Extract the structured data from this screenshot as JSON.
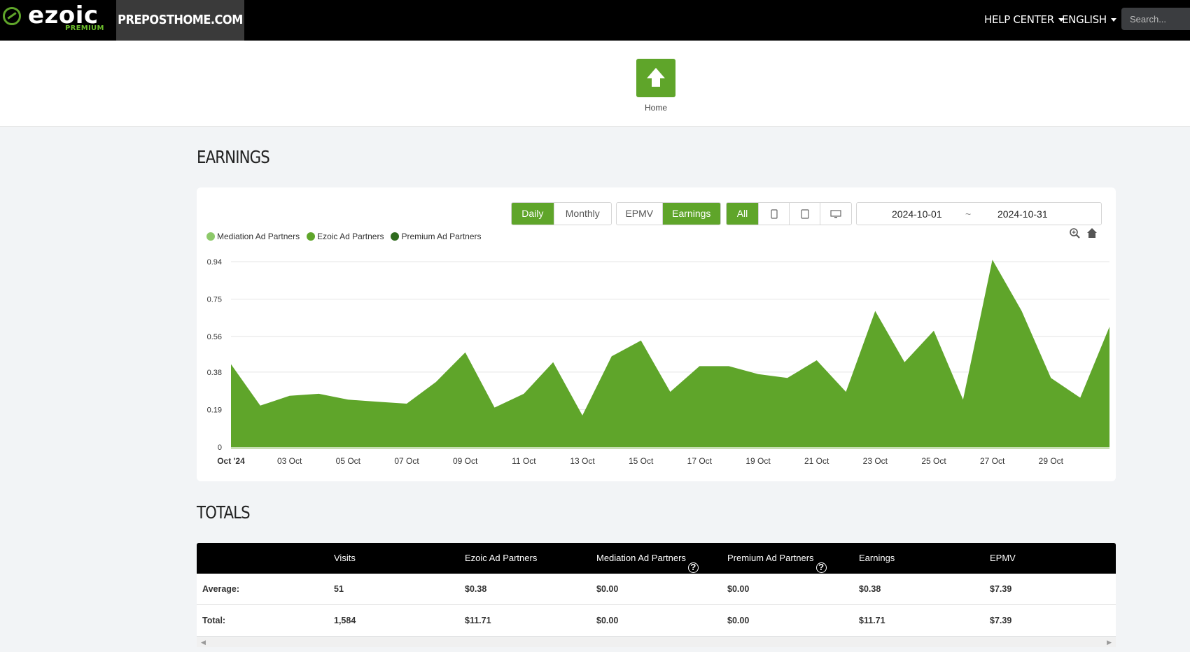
{
  "topbar": {
    "logo_text": "ezoic",
    "logo_sub": "PREMIUM",
    "site_name": "PREPOSTHOME.COM",
    "help_center": "HELP CENTER",
    "language": "ENGLISH",
    "search_placeholder": "Search..."
  },
  "home": {
    "label": "Home"
  },
  "earnings": {
    "title": "EARNINGS",
    "period_buttons": [
      "Daily",
      "Monthly"
    ],
    "active_period": "Daily",
    "metric_buttons": [
      "EPMV",
      "Earnings"
    ],
    "active_metric": "Earnings",
    "device_all": "All",
    "date_start": "2024-10-01",
    "date_sep": "~",
    "date_end": "2024-10-31"
  },
  "colors": {
    "brand_green": "#5fa52a",
    "mediation": "#8dc96a",
    "ezoic": "#5fa52a",
    "premium": "#2f6b1e"
  },
  "chart_data": {
    "type": "area",
    "legend": [
      "Mediation Ad Partners",
      "Ezoic Ad Partners",
      "Premium Ad Partners"
    ],
    "x_tick_labels": [
      "Oct '24",
      "03 Oct",
      "05 Oct",
      "07 Oct",
      "09 Oct",
      "11 Oct",
      "13 Oct",
      "15 Oct",
      "17 Oct",
      "19 Oct",
      "21 Oct",
      "23 Oct",
      "25 Oct",
      "27 Oct",
      "29 Oct"
    ],
    "y_ticks": [
      "0",
      "0.19",
      "0.38",
      "0.56",
      "0.75",
      "0.94"
    ],
    "ylim": [
      0,
      0.94
    ],
    "x": [
      "2024-10-01",
      "2024-10-02",
      "2024-10-03",
      "2024-10-04",
      "2024-10-05",
      "2024-10-06",
      "2024-10-07",
      "2024-10-08",
      "2024-10-09",
      "2024-10-10",
      "2024-10-11",
      "2024-10-12",
      "2024-10-13",
      "2024-10-14",
      "2024-10-15",
      "2024-10-16",
      "2024-10-17",
      "2024-10-18",
      "2024-10-19",
      "2024-10-20",
      "2024-10-21",
      "2024-10-22",
      "2024-10-23",
      "2024-10-24",
      "2024-10-25",
      "2024-10-26",
      "2024-10-27",
      "2024-10-28",
      "2024-10-29",
      "2024-10-30",
      "2024-10-31"
    ],
    "series": [
      {
        "name": "Ezoic Ad Partners",
        "values": [
          0.42,
          0.21,
          0.26,
          0.27,
          0.24,
          0.23,
          0.22,
          0.33,
          0.48,
          0.2,
          0.27,
          0.43,
          0.16,
          0.46,
          0.54,
          0.28,
          0.41,
          0.41,
          0.37,
          0.35,
          0.44,
          0.28,
          0.69,
          0.43,
          0.59,
          0.24,
          0.95,
          0.69,
          0.35,
          0.25,
          0.61
        ]
      },
      {
        "name": "Mediation Ad Partners",
        "values": [
          0,
          0,
          0,
          0,
          0,
          0,
          0,
          0,
          0,
          0,
          0,
          0,
          0,
          0,
          0,
          0,
          0,
          0,
          0,
          0,
          0,
          0,
          0,
          0,
          0,
          0,
          0,
          0,
          0,
          0,
          0
        ]
      },
      {
        "name": "Premium Ad Partners",
        "values": [
          0,
          0,
          0,
          0,
          0,
          0,
          0,
          0,
          0,
          0,
          0,
          0,
          0,
          0,
          0,
          0,
          0,
          0,
          0,
          0,
          0,
          0,
          0,
          0,
          0,
          0,
          0,
          0,
          0,
          0,
          0
        ]
      }
    ]
  },
  "totals": {
    "title": "TOTALS",
    "columns": [
      "Visits",
      "Ezoic Ad Partners",
      "Mediation Ad Partners",
      "Premium Ad Partners",
      "Earnings",
      "EPMV"
    ],
    "rows": [
      {
        "label": "Average:",
        "values": [
          "51",
          "$0.38",
          "$0.00",
          "$0.00",
          "$0.38",
          "$7.39"
        ]
      },
      {
        "label": "Total:",
        "values": [
          "1,584",
          "$11.71",
          "$0.00",
          "$0.00",
          "$11.71",
          "$7.39"
        ]
      }
    ]
  }
}
